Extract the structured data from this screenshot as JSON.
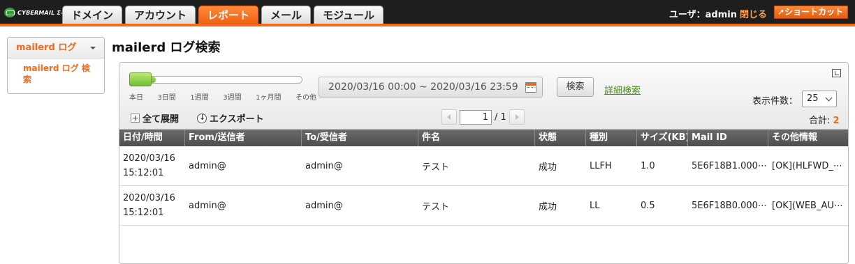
{
  "app": {
    "logo_text": "CYBERMAIL Σ-ST"
  },
  "tabs": [
    "ドメイン",
    "アカウント",
    "レポート",
    "メール",
    "モジュール"
  ],
  "active_tab": "レポート",
  "user": {
    "label": "ユーザ：admin",
    "logout": "閉じる",
    "shortcut": "ショートカット"
  },
  "sidebar": {
    "header": "mailerd ログ",
    "items": [
      "mailerd ログ 検索"
    ]
  },
  "page_title": "mailerd ログ検索",
  "search": {
    "range_labels": [
      "本日",
      "3日間",
      "1週間",
      "3週間",
      "1ヶ月間",
      "その他"
    ],
    "selected_range": "本日",
    "date_range": "2020/03/16 00:00 ~ 2020/03/16 23:59",
    "search_button": "検索",
    "advanced_link": "詳細検索",
    "per_page_label": "表示件数：",
    "per_page_value": "25"
  },
  "toolbar": {
    "expand_all": "全て展開",
    "export": "エクスポート"
  },
  "pager": {
    "current": "1",
    "total": "/ 1"
  },
  "total": {
    "label": "合計:",
    "count": "2"
  },
  "table": {
    "columns": [
      "日付/時間",
      "From/送信者",
      "To/受信者",
      "件名",
      "状態",
      "種別",
      "サイズ(KB)",
      "Mail ID",
      "その他情報"
    ],
    "rows": [
      [
        "2020/03/16 15:12:01",
        "admin@",
        "admin@",
        "テスト",
        "成功",
        "LLFH",
        "1.0",
        "5E6F18B1.000⋯",
        "[OK](HLFWD_⋯"
      ],
      [
        "2020/03/16 15:12:01",
        "admin@",
        "admin@",
        "テスト",
        "成功",
        "LL",
        "0.5",
        "5E6F18B0.000⋯",
        "[OK](WEB_AU⋯"
      ]
    ]
  },
  "colors": {
    "accent": "#f26a1b",
    "slider_green": "#74bb34",
    "link_green": "#4c8a1f",
    "header_dark": "#1e1e1e"
  }
}
